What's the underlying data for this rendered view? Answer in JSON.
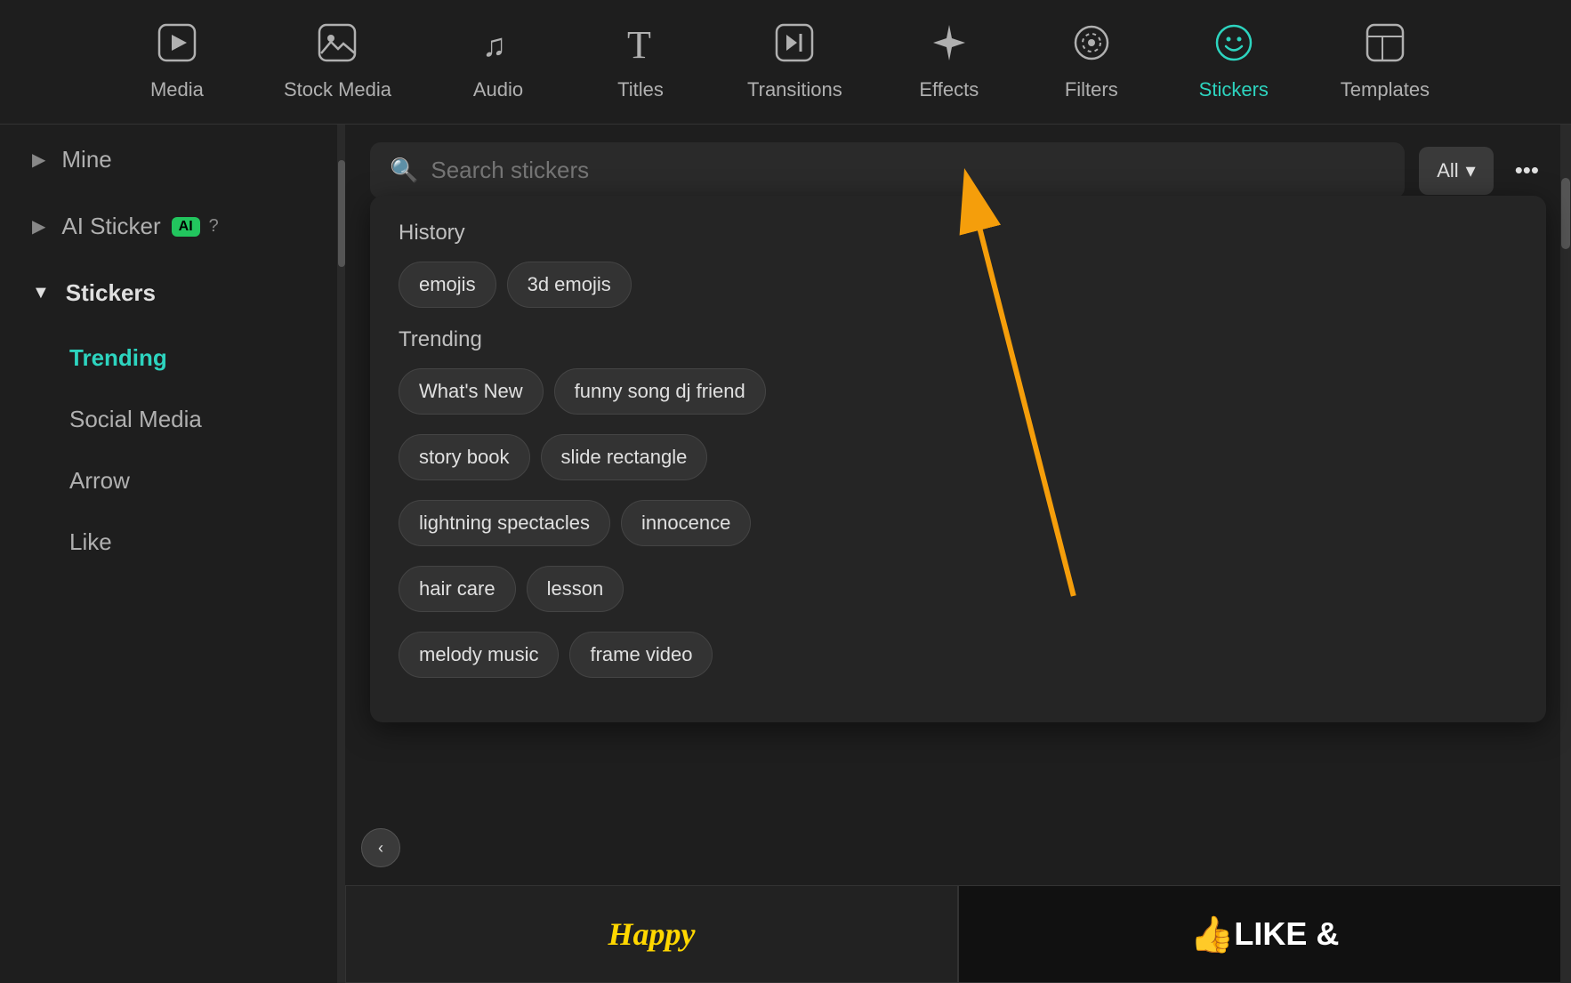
{
  "toolbar": {
    "items": [
      {
        "id": "media",
        "label": "Media",
        "icon": "▶",
        "iconType": "media"
      },
      {
        "id": "stock-media",
        "label": "Stock Media",
        "icon": "🖼",
        "iconType": "stock"
      },
      {
        "id": "audio",
        "label": "Audio",
        "icon": "♫",
        "iconType": "audio"
      },
      {
        "id": "titles",
        "label": "Titles",
        "icon": "T",
        "iconType": "titles"
      },
      {
        "id": "transitions",
        "label": "Transitions",
        "icon": "▶|",
        "iconType": "transitions"
      },
      {
        "id": "effects",
        "label": "Effects",
        "icon": "✦",
        "iconType": "effects"
      },
      {
        "id": "filters",
        "label": "Filters",
        "icon": "◎",
        "iconType": "filters"
      },
      {
        "id": "stickers",
        "label": "Stickers",
        "icon": "☺",
        "iconType": "stickers",
        "active": true
      },
      {
        "id": "templates",
        "label": "Templates",
        "icon": "▤",
        "iconType": "templates"
      }
    ]
  },
  "sidebar": {
    "items": [
      {
        "id": "mine",
        "label": "Mine",
        "type": "expandable",
        "expanded": false
      },
      {
        "id": "ai-sticker",
        "label": "AI Sticker",
        "type": "ai",
        "expanded": false
      },
      {
        "id": "stickers",
        "label": "Stickers",
        "type": "expandable",
        "expanded": true,
        "children": [
          {
            "id": "trending",
            "label": "Trending",
            "active": true
          },
          {
            "id": "social-media",
            "label": "Social Media",
            "active": false
          },
          {
            "id": "arrow",
            "label": "Arrow",
            "active": false
          },
          {
            "id": "like",
            "label": "Like",
            "active": false
          }
        ]
      }
    ]
  },
  "search": {
    "placeholder": "Search stickers",
    "filter_label": "All",
    "more_icon": "•••"
  },
  "dropdown": {
    "history_label": "History",
    "history_tags": [
      "emojis",
      "3d emojis"
    ],
    "trending_label": "Trending",
    "trending_tags": [
      "What's New",
      "funny song dj friend",
      "story book",
      "slide rectangle",
      "lightning spectacles",
      "innocence",
      "hair care",
      "lesson",
      "melody music",
      "frame video"
    ]
  },
  "bottom_stickers": [
    {
      "type": "text",
      "content": "Happy"
    },
    {
      "type": "like",
      "emoji": "👍",
      "text": "LIKE &"
    }
  ],
  "collapse_btn": "‹",
  "arrow_annotation": {
    "description": "orange arrow pointing to Stickers icon in toolbar"
  }
}
